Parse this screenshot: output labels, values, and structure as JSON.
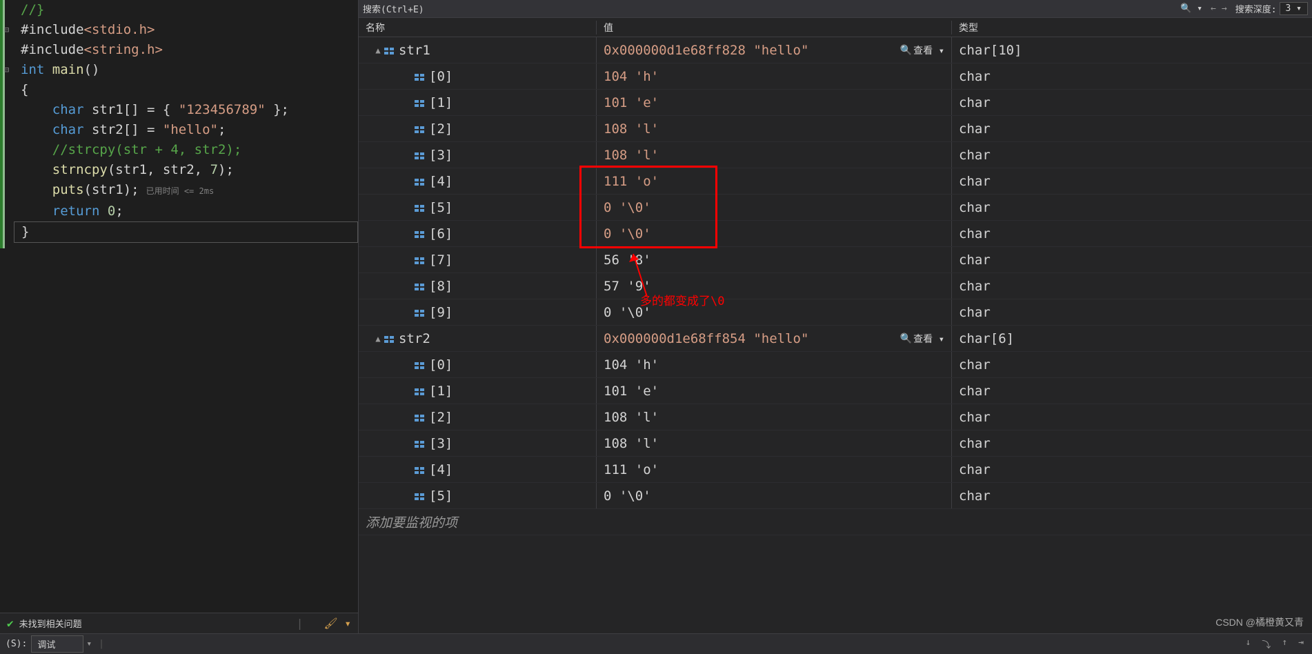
{
  "search": {
    "placeholder": "搜索(Ctrl+E)",
    "depth_label": "搜索深度:",
    "depth_value": "3"
  },
  "headers": {
    "name": "名称",
    "value": "值",
    "type": "类型"
  },
  "code_lines": [
    {
      "collapse": "",
      "tokens": [
        {
          "cls": "tk-comment",
          "t": "//}"
        }
      ]
    },
    {
      "collapse": "⊟",
      "tokens": [
        {
          "cls": "tk-default",
          "t": "#include"
        },
        {
          "cls": "tk-string",
          "t": "<stdio.h>"
        }
      ]
    },
    {
      "collapse": "",
      "tokens": [
        {
          "cls": "tk-default",
          "t": "#include"
        },
        {
          "cls": "tk-string",
          "t": "<string.h>"
        }
      ]
    },
    {
      "collapse": "⊟",
      "tokens": [
        {
          "cls": "tk-keyword",
          "t": "int"
        },
        {
          "cls": "tk-default",
          "t": " "
        },
        {
          "cls": "tk-func",
          "t": "main"
        },
        {
          "cls": "tk-default",
          "t": "()"
        }
      ]
    },
    {
      "collapse": "",
      "tokens": [
        {
          "cls": "tk-default",
          "t": "{"
        }
      ]
    },
    {
      "collapse": "",
      "tokens": [
        {
          "cls": "tk-default",
          "t": "    "
        },
        {
          "cls": "tk-keyword",
          "t": "char"
        },
        {
          "cls": "tk-default",
          "t": " str1[] = { "
        },
        {
          "cls": "tk-string",
          "t": "\"123456789\""
        },
        {
          "cls": "tk-default",
          "t": " };"
        }
      ]
    },
    {
      "collapse": "",
      "tokens": [
        {
          "cls": "tk-default",
          "t": "    "
        },
        {
          "cls": "tk-keyword",
          "t": "char"
        },
        {
          "cls": "tk-default",
          "t": " str2[] = "
        },
        {
          "cls": "tk-string",
          "t": "\"hello\""
        },
        {
          "cls": "tk-default",
          "t": ";"
        }
      ]
    },
    {
      "collapse": "",
      "tokens": [
        {
          "cls": "tk-default",
          "t": "    "
        },
        {
          "cls": "tk-comment",
          "t": "//strcpy(str + 4, str2);"
        }
      ]
    },
    {
      "collapse": "",
      "tokens": [
        {
          "cls": "tk-default",
          "t": "    "
        },
        {
          "cls": "tk-func",
          "t": "strncpy"
        },
        {
          "cls": "tk-default",
          "t": "(str1, str2, "
        },
        {
          "cls": "tk-number",
          "t": "7"
        },
        {
          "cls": "tk-default",
          "t": ");"
        }
      ]
    },
    {
      "collapse": "",
      "tokens": [
        {
          "cls": "tk-default",
          "t": "    "
        },
        {
          "cls": "tk-func",
          "t": "puts"
        },
        {
          "cls": "tk-default",
          "t": "(str1);"
        }
      ],
      "hint": "已用时间 <= 2ms"
    },
    {
      "collapse": "",
      "tokens": [
        {
          "cls": "tk-default",
          "t": "    "
        },
        {
          "cls": "tk-keyword",
          "t": "return"
        },
        {
          "cls": "tk-default",
          "t": " "
        },
        {
          "cls": "tk-number",
          "t": "0"
        },
        {
          "cls": "tk-default",
          "t": ";"
        }
      ]
    },
    {
      "collapse": "",
      "tokens": [
        {
          "cls": "tk-default",
          "t": "}"
        }
      ],
      "cursor": true
    }
  ],
  "status": {
    "no_issues": "未找到相关问题"
  },
  "watch": [
    {
      "indent": 0,
      "expand": "▲",
      "name": "str1",
      "value": "0x000000d1e68ff828 \"hello\"",
      "type": "char[10]",
      "changed": true,
      "viewbtn": true
    },
    {
      "indent": 1,
      "name": "[0]",
      "value": "104 'h'",
      "type": "char",
      "changed": true
    },
    {
      "indent": 1,
      "name": "[1]",
      "value": "101 'e'",
      "type": "char",
      "changed": true
    },
    {
      "indent": 1,
      "name": "[2]",
      "value": "108 'l'",
      "type": "char",
      "changed": true
    },
    {
      "indent": 1,
      "name": "[3]",
      "value": "108 'l'",
      "type": "char",
      "changed": true
    },
    {
      "indent": 1,
      "name": "[4]",
      "value": "111 'o'",
      "type": "char",
      "changed": true
    },
    {
      "indent": 1,
      "name": "[5]",
      "value": "0 '\\0'",
      "type": "char",
      "changed": true
    },
    {
      "indent": 1,
      "name": "[6]",
      "value": "0 '\\0'",
      "type": "char",
      "changed": true
    },
    {
      "indent": 1,
      "name": "[7]",
      "value": "56 '8'",
      "type": "char",
      "changed": false
    },
    {
      "indent": 1,
      "name": "[8]",
      "value": "57 '9'",
      "type": "char",
      "changed": false
    },
    {
      "indent": 1,
      "name": "[9]",
      "value": "0 '\\0'",
      "type": "char",
      "changed": false
    },
    {
      "indent": 0,
      "expand": "▲",
      "name": "str2",
      "value": "0x000000d1e68ff854 \"hello\"",
      "type": "char[6]",
      "changed": true,
      "viewbtn": true
    },
    {
      "indent": 1,
      "name": "[0]",
      "value": "104 'h'",
      "type": "char",
      "changed": false
    },
    {
      "indent": 1,
      "name": "[1]",
      "value": "101 'e'",
      "type": "char",
      "changed": false
    },
    {
      "indent": 1,
      "name": "[2]",
      "value": "108 'l'",
      "type": "char",
      "changed": false
    },
    {
      "indent": 1,
      "name": "[3]",
      "value": "108 'l'",
      "type": "char",
      "changed": false
    },
    {
      "indent": 1,
      "name": "[4]",
      "value": "111 'o'",
      "type": "char",
      "changed": false
    },
    {
      "indent": 1,
      "name": "[5]",
      "value": "0 '\\0'",
      "type": "char",
      "changed": false
    }
  ],
  "add_watch": "添加要监视的项",
  "view_label": "查看",
  "bottom": {
    "label": "(S):",
    "combo": "调试"
  },
  "annotation": "多的都变成了\\0",
  "watermark": "CSDN @橘橙黄又青"
}
